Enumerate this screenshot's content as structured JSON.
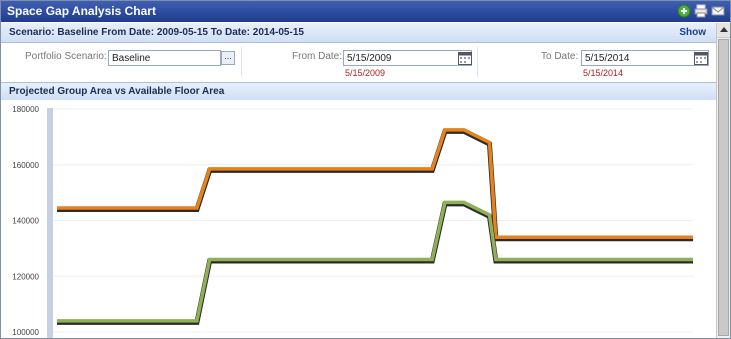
{
  "window": {
    "title": "Space Gap Analysis Chart",
    "icons": [
      "add-icon",
      "print-icon",
      "email-icon"
    ]
  },
  "scenario_bar": {
    "text": "Scenario: Baseline From Date: 2009-05-15 To Date: 2014-05-15",
    "show_label": "Show"
  },
  "form": {
    "portfolio_label": "Portfolio Scenario:",
    "portfolio_value": "Baseline",
    "portfolio_button": "...",
    "from_label": "From Date:",
    "from_value": "5/15/2009",
    "from_hint": "5/15/2009",
    "to_label": "To Date:",
    "to_value": "5/15/2014",
    "to_hint": "5/15/2014"
  },
  "chart_section": {
    "title": "Projected Group Area vs Available Floor Area"
  },
  "colors": {
    "orange_series": "#e5821d",
    "green_series": "#8fb054",
    "title_bar": "#2a4a9f",
    "hint_red": "#b02020"
  },
  "chart_data": {
    "type": "line",
    "title": "",
    "xlabel": "",
    "ylabel": "",
    "ytick_labels": [
      "180000",
      "160000",
      "140000",
      "120000",
      "100000"
    ],
    "yticks": [
      180000,
      160000,
      140000,
      120000,
      100000
    ],
    "ylim": [
      100000,
      180000
    ],
    "x": [
      0,
      22,
      24,
      59,
      61,
      64,
      68,
      69,
      100
    ],
    "series": [
      {
        "name": "",
        "color": "#e5821d",
        "values": [
          144500,
          144500,
          158500,
          158500,
          172500,
          172500,
          168000,
          134000,
          134000
        ]
      },
      {
        "name": "",
        "color": "#8fb054",
        "values": [
          104000,
          104000,
          126000,
          126000,
          146500,
          146500,
          142000,
          126000,
          126000
        ]
      }
    ],
    "grid": true,
    "legend": "none"
  }
}
